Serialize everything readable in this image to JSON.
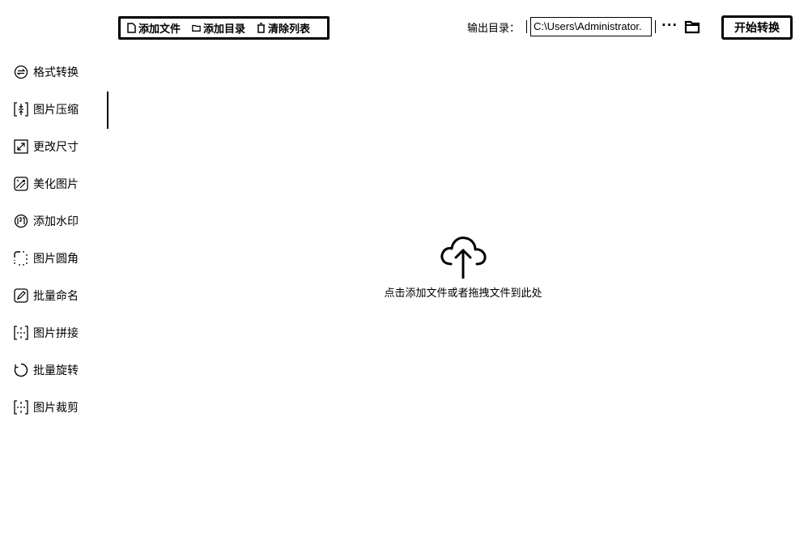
{
  "toolbar": {
    "add_file": "添加文件",
    "add_folder": "添加目录",
    "clear_list": "清除列表"
  },
  "output": {
    "label": "输出目录：",
    "path": "C:\\Users\\Administrator.",
    "more": "···",
    "start_button": "开始转换"
  },
  "sidebar": {
    "active_index": 1,
    "items": [
      {
        "label": "格式转换",
        "icon": "swap-icon"
      },
      {
        "label": "图片压缩",
        "icon": "compress-icon"
      },
      {
        "label": "更改尺寸",
        "icon": "resize-icon"
      },
      {
        "label": "美化图片",
        "icon": "beautify-icon"
      },
      {
        "label": "添加水印",
        "icon": "watermark-icon"
      },
      {
        "label": "图片圆角",
        "icon": "rounded-corner-icon"
      },
      {
        "label": "批量命名",
        "icon": "rename-icon"
      },
      {
        "label": "图片拼接",
        "icon": "stitch-icon"
      },
      {
        "label": "批量旋转",
        "icon": "rotate-icon"
      },
      {
        "label": "图片裁剪",
        "icon": "crop-icon"
      }
    ]
  },
  "dropzone": {
    "hint": "点击添加文件或者拖拽文件到此处"
  }
}
